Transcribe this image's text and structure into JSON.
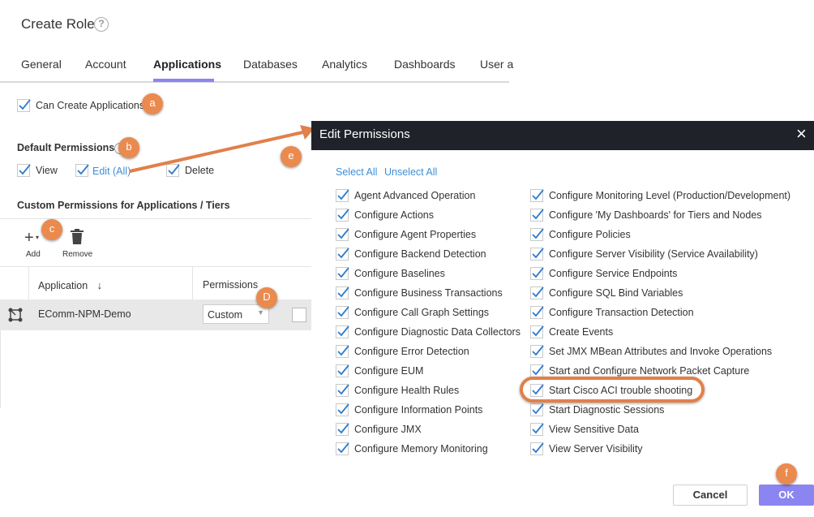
{
  "header": {
    "title": "Create Role",
    "help_icon": "question-circle-icon"
  },
  "tabs": [
    {
      "label": "General"
    },
    {
      "label": "Account"
    },
    {
      "label": "Applications",
      "active": true
    },
    {
      "label": "Databases"
    },
    {
      "label": "Analytics"
    },
    {
      "label": "Dashboards"
    },
    {
      "label": "User a"
    }
  ],
  "can_create": {
    "label": "Can Create Applications",
    "checked": true
  },
  "default_permissions": {
    "title": "Default Permissions",
    "view": "View",
    "edit": "Edit (All)",
    "delete": "Delete"
  },
  "custom": {
    "title": "Custom Permissions for Applications / Tiers",
    "add_label": "Add",
    "remove_label": "Remove",
    "columns": {
      "application": "Application",
      "permissions": "Permissions"
    },
    "row": {
      "application": "EComm-NPM-Demo",
      "permission": "Custom"
    }
  },
  "badges": {
    "a": "a",
    "b": "b",
    "c": "c",
    "d": "D",
    "e": "e",
    "f": "f"
  },
  "dialog": {
    "title": "Edit Permissions",
    "select_all": "Select All",
    "unselect_all": "Unselect All",
    "left": [
      "Agent Advanced Operation",
      "Configure Actions",
      "Configure Agent Properties",
      "Configure Backend Detection",
      "Configure Baselines",
      "Configure Business Transactions",
      "Configure Call Graph Settings",
      "Configure Diagnostic Data Collectors",
      "Configure Error Detection",
      "Configure EUM",
      "Configure Health Rules",
      "Configure Information Points",
      "Configure JMX",
      "Configure Memory Monitoring"
    ],
    "right": [
      "Configure Monitoring Level (Production/Development)",
      "Configure 'My Dashboards' for Tiers and Nodes",
      "Configure Policies",
      "Configure Server Visibility (Service Availability)",
      "Configure Service Endpoints",
      "Configure SQL Bind Variables",
      "Configure Transaction Detection",
      "Create Events",
      "Set JMX MBean Attributes and Invoke Operations",
      "Start and Configure Network Packet Capture",
      "Start Cisco ACI trouble shooting",
      "Start Diagnostic Sessions",
      "View Sensitive Data",
      "View Server Visibility"
    ],
    "highlighted": "Start Cisco ACI trouble shooting",
    "cancel": "Cancel",
    "ok": "OK",
    "accent": "#8a85f0",
    "check_color": "#2e7bcf"
  }
}
